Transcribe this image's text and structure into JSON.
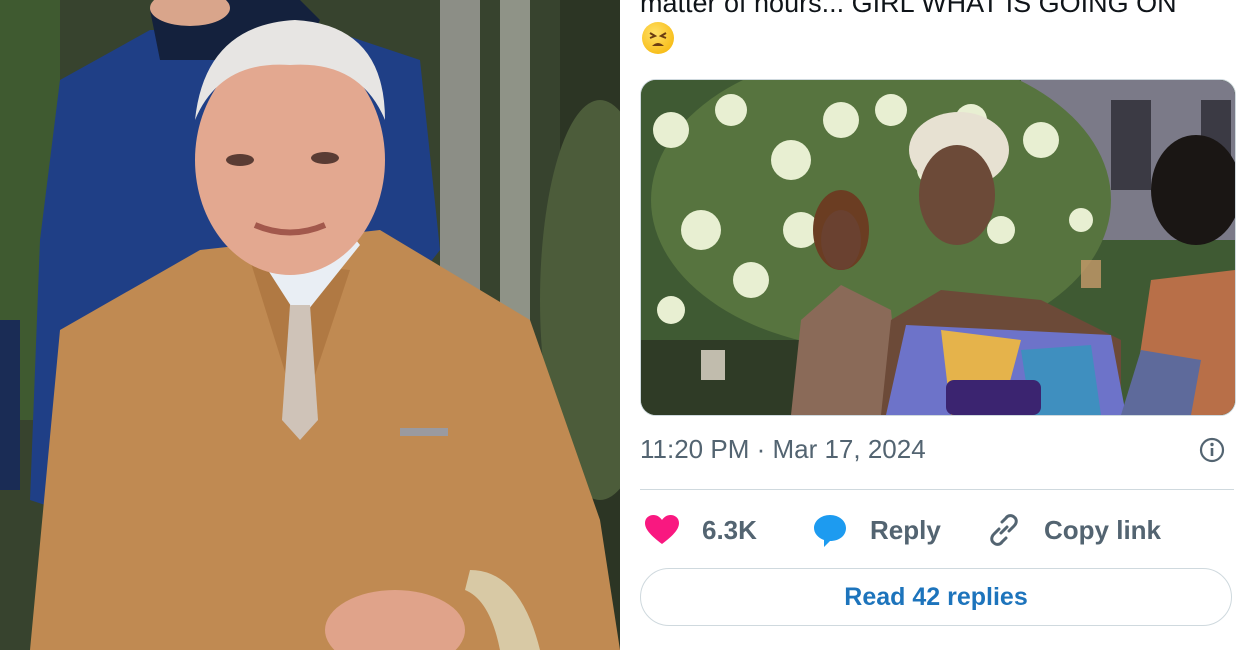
{
  "tweet": {
    "text": "matter of hours... GIRL WHAT IS GOING ON",
    "emoji": "tired-face-emoji",
    "timestamp": "11:20 PM · Mar 17, 2024",
    "like_count": "6.3K",
    "reply_label": "Reply",
    "copy_link_label": "Copy link",
    "read_replies_label": "Read 42 replies"
  },
  "colors": {
    "like": "#f91880",
    "reply": "#1d9bf0",
    "muted": "#536471",
    "link": "#1d74bc",
    "border": "#cfd9de"
  }
}
